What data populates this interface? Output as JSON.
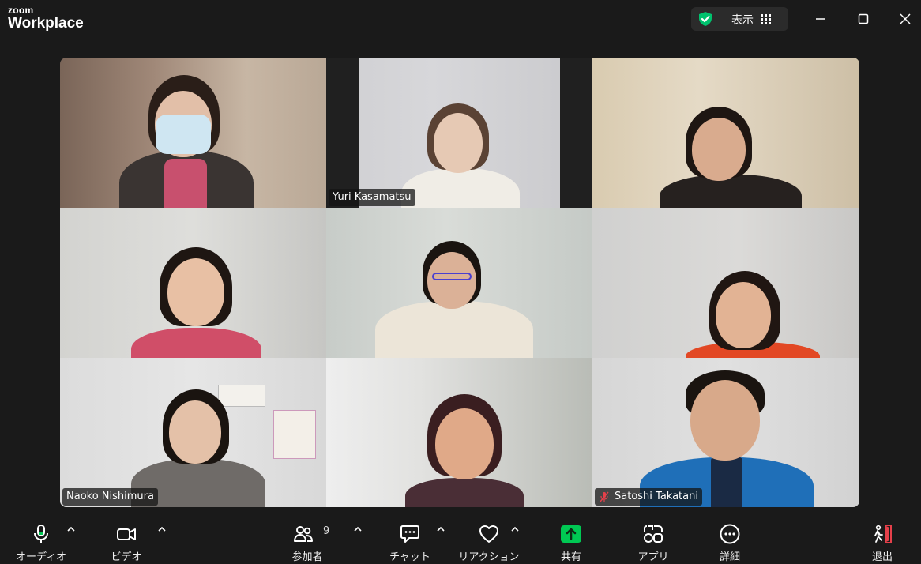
{
  "app": {
    "logo_top": "zoom",
    "logo_main": "Workplace"
  },
  "header": {
    "view_label": "表示"
  },
  "participants": [
    {
      "name": ""
    },
    {
      "name": "Yuri Kasamatsu",
      "active_speaker": true
    },
    {
      "name": ""
    },
    {
      "name": ""
    },
    {
      "name": ""
    },
    {
      "name": ""
    },
    {
      "name": "Naoko Nishimura"
    },
    {
      "name": ""
    },
    {
      "name": "Satoshi Takatani",
      "muted": true
    }
  ],
  "toolbar": {
    "audio_label": "オーディオ",
    "video_label": "ビデオ",
    "participants_label": "参加者",
    "participants_count": "9",
    "chat_label": "チャット",
    "reactions_label": "リアクション",
    "share_label": "共有",
    "apps_label": "アプリ",
    "more_label": "詳細",
    "leave_label": "退出"
  },
  "colors": {
    "active_speaker": "#00d97e",
    "share_green": "#00c853",
    "leave_red": "#e5404a",
    "shield_green": "#00c26e"
  }
}
